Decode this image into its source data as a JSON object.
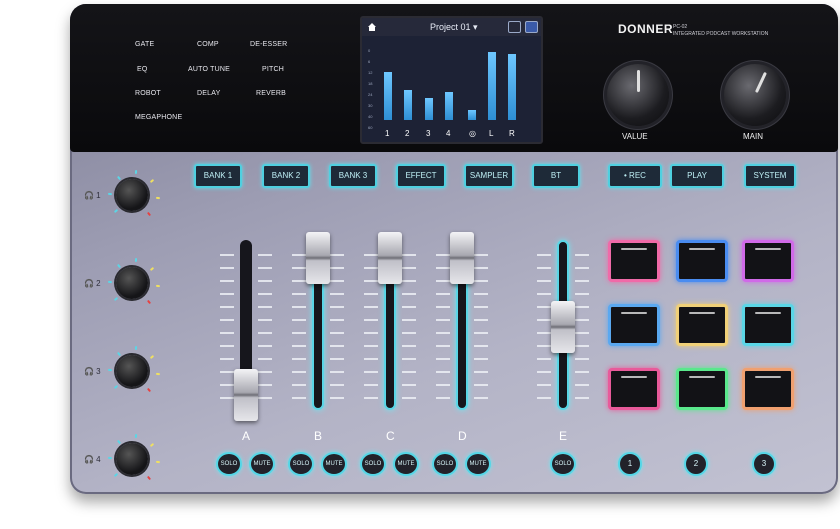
{
  "effects": [
    "GATE",
    "COMP",
    "DE-ESSER",
    "EQ",
    "AUTO TUNE",
    "PITCH",
    "ROBOT",
    "DELAY",
    "REVERB",
    "MEGAPHONE"
  ],
  "screen": {
    "title": "Project 01 ▾",
    "scale_marks": [
      "0",
      "6",
      "12",
      "18",
      "24",
      "30",
      "40",
      "60"
    ],
    "channels": [
      "1",
      "2",
      "3",
      "4",
      "◎",
      "L",
      "R"
    ],
    "levels_percent": [
      60,
      38,
      28,
      35,
      12,
      85,
      82
    ]
  },
  "brand": {
    "logo": "DONNER",
    "model": "PC-02",
    "subtitle": "INTEGRATED PODCAST WORKSTATION"
  },
  "knobs": {
    "value_label": "VALUE",
    "main_label": "MAIN"
  },
  "buttons": [
    "BANK 1",
    "BANK 2",
    "BANK 3",
    "EFFECT",
    "SAMPLER",
    "BT",
    "• REC",
    "PLAY",
    "SYSTEM"
  ],
  "headphones": [
    "1",
    "2",
    "3",
    "4"
  ],
  "channels": [
    "A",
    "B",
    "C",
    "D",
    "E"
  ],
  "solo_label": "SOLO",
  "mute_label": "MUTE",
  "sample_buttons": [
    "1",
    "2",
    "3"
  ],
  "colors": {
    "accent": "#4fd0e0",
    "pad_colors": [
      "#f06aa8",
      "#4a8cf0",
      "#d06ae8",
      "#5aa8f0",
      "#f0d078",
      "#5ad6e6",
      "#e85a9a",
      "#5ae88c",
      "#f0a070"
    ]
  }
}
